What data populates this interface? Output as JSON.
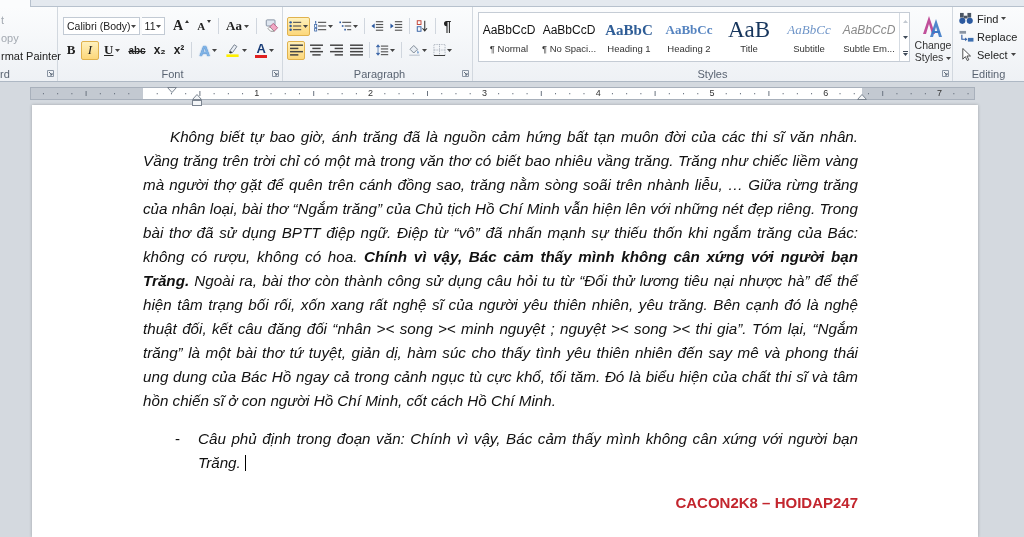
{
  "clipboard": {
    "items": [
      {
        "label": "t",
        "disabled": true
      },
      {
        "label": "opy",
        "disabled": true
      },
      {
        "label": "rmat Painter",
        "disabled": false
      }
    ],
    "group_label": "rd"
  },
  "font": {
    "font_name": "Calibri (Body)",
    "font_size": "11",
    "grow_font": "A",
    "shrink_font": "A",
    "change_case": "Aa",
    "format_buttons": [
      {
        "kind": "bold",
        "label": "B",
        "selected": false
      },
      {
        "kind": "italic",
        "label": "I",
        "selected": true
      },
      {
        "kind": "underline",
        "label": "U",
        "selected": false
      },
      {
        "kind": "strikethrough",
        "label": "abc",
        "selected": false
      },
      {
        "kind": "subscript",
        "label": "x₂",
        "selected": false
      },
      {
        "kind": "superscript",
        "label": "x²",
        "selected": false
      }
    ],
    "text_effects": "A",
    "font_color": "A",
    "group_label": "Font"
  },
  "paragraph": {
    "list_buttons": [
      {
        "kind": "bullets",
        "selected": true
      },
      {
        "kind": "numbering",
        "selected": false
      },
      {
        "kind": "multilevel",
        "selected": false
      }
    ],
    "show_marks": "¶",
    "alignment": [
      {
        "kind": "left",
        "selected": true
      },
      {
        "kind": "center",
        "selected": false
      },
      {
        "kind": "right",
        "selected": false
      },
      {
        "kind": "justify",
        "selected": false
      }
    ],
    "group_label": "Paragraph"
  },
  "styles": {
    "items": [
      {
        "kind": "normal",
        "preview": "AaBbCcD",
        "name": "¶ Normal",
        "selected": false
      },
      {
        "kind": "no_spacing",
        "preview": "AaBbCcD",
        "name": "¶ No Spaci...",
        "selected": false
      },
      {
        "kind": "heading_1",
        "preview": "AaBbC",
        "name": "Heading 1",
        "selected": false
      },
      {
        "kind": "heading_2",
        "preview": "AaBbCc",
        "name": "Heading 2",
        "selected": false
      },
      {
        "kind": "title",
        "preview": "AaB",
        "name": "Title",
        "selected": false
      },
      {
        "kind": "subtitle",
        "preview": "AaBbCc",
        "name": "Subtitle",
        "selected": false
      },
      {
        "kind": "subtle_emphasis",
        "preview": "AaBbCcD",
        "name": "Subtle Em...",
        "selected": false
      }
    ],
    "scroll_up_disabled": true,
    "change_styles": "Change Styles",
    "group_label": "Styles"
  },
  "editing": {
    "items": [
      {
        "kind": "find",
        "label": "Find",
        "dropdown": true
      },
      {
        "kind": "replace",
        "label": "Replace",
        "dropdown": false
      },
      {
        "kind": "select",
        "label": "Select",
        "dropdown": true
      }
    ],
    "group_label": "Editing"
  },
  "ruler": {
    "numbers": [
      "1",
      "2",
      "3",
      "4",
      "5",
      "6",
      "7"
    ]
  },
  "document": {
    "paragraph": "Không biết tự bao giờ, ánh trăng đã là nguồn cảm hứng bất tạn muôn đời của các thi sĩ văn nhân. Vầng trăng trên trời chỉ có một mà trong văn thơ có biết bao nhiêu vầng trăng. Trăng như chiếc liềm vàng mà người thợ gặt để quên trên cánh đồng sao, trăng nằm sòng soãi trên nhành liễu, … Giữa rừng trăng của nhân loại, bài thơ “Ngắm trăng” của Chủ tịch Hồ Chí Minh vẫn hiện lên với những nét đẹp riêng. Trong bài thơ đã sử dụng BPTT điệp ngữ. Điệp từ “vô” đã nhấn mạnh sự thiếu thốn khi ngắm trăng của Bác: không có rượu, không có hoa. **Chính vì vậy, Bác cảm thấy mình không cân xứng với người bạn Trăng.** Ngoài ra, bài thơ còn thành công sử dụng câu hỏi tu từ “Đối thử lương tiêu nại nhược hà” để thể hiện tâm trạng bối rối, xốn xang rất nghệ sĩ của người yêu thiên nhiên, yêu trăng. Bên cạnh đó là nghệ thuật đối, kết câu đăng đối “nhân >< song >< minh nguyệt ; nguyệt >< song >< thi gia”. Tóm lại, “Ngắm trăng” là một bài thơ tứ tuyệt, giản dị, hàm súc cho thấy tình yêu thiên nhiên đến say mê và phong thái ung dung của Bác Hồ ngay cả trong cảnh ngục tù cực khổ, tối tăm. Đó là biểu hiện của chất thi sĩ và tâm hồn chiến sĩ ở con người Hồ Chí Minh, cốt cách Hồ Chí Minh.",
    "list_items": [
      {
        "marker": "-",
        "text": "Câu phủ định trong đoạn văn: Chính vì vậy, Bác cảm thấy mình không cân xứng với người bạn Trăng.",
        "has_cursor": true
      }
    ],
    "signature": "CACON2K8 – HOIDAP247"
  }
}
